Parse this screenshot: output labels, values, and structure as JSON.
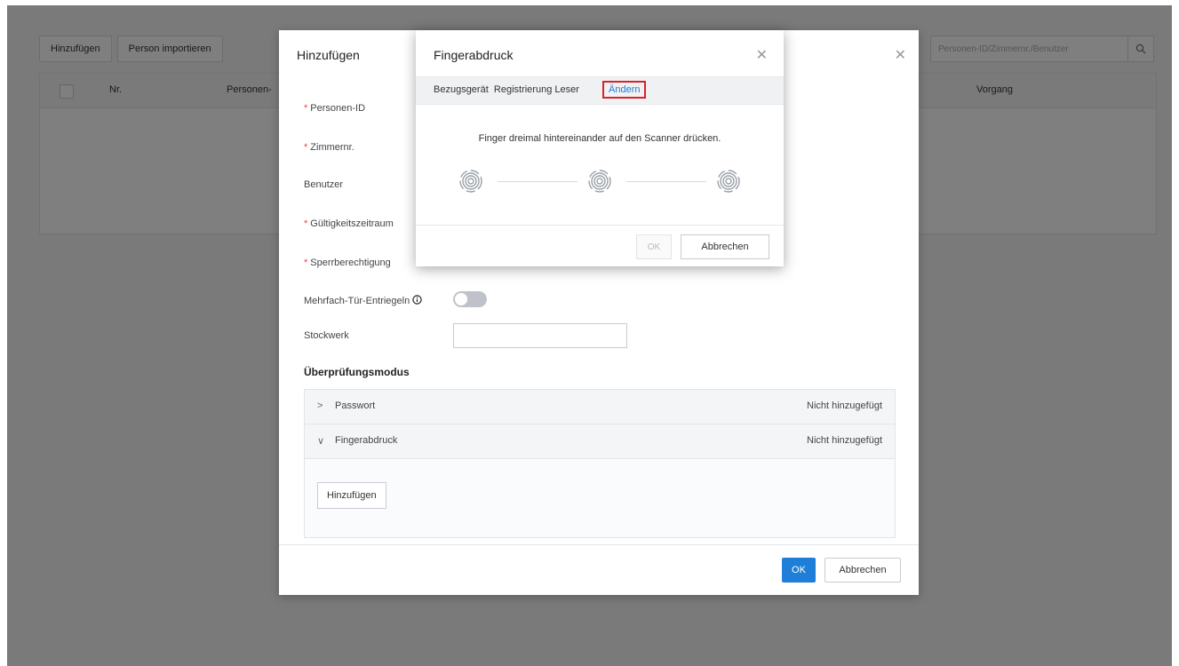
{
  "background": {
    "toolbar": {
      "add_label": "Hinzufügen",
      "import_label": "Person importieren"
    },
    "search": {
      "placeholder": "Personen-ID/Zimmernr./Benutzer"
    },
    "table": {
      "col_no": "Nr.",
      "col_person": "Personen-",
      "col_action": "Vorgang"
    }
  },
  "add_dialog": {
    "title": "Hinzufügen",
    "fields": {
      "person_id": "Personen-ID",
      "room_no": "Zimmernr.",
      "user": "Benutzer",
      "validity": "Gültigkeitszeitraum",
      "lock_permission": "Sperrberechtigung",
      "multi_door": "Mehrfach-Tür-Entriegeln",
      "floor": "Stockwerk"
    },
    "verification": {
      "title": "Überprüfungsmodus",
      "rows": [
        {
          "chevron": ">",
          "label": "Passwort",
          "status": "Nicht hinzugefügt"
        },
        {
          "chevron": "∨",
          "label": "Fingerabdruck",
          "status": "Nicht hinzugefügt"
        }
      ],
      "add_label": "Hinzufügen"
    },
    "ok_label": "OK",
    "cancel_label": "Abbrechen"
  },
  "fingerprint_dialog": {
    "title": "Fingerabdruck",
    "device_label": "Bezugsgerät",
    "device_value": "Registrierung Leser",
    "change_label": "Ändern",
    "instruction": "Finger dreimal hintereinander auf den Scanner drücken.",
    "ok_label": "OK",
    "cancel_label": "Abbrechen"
  }
}
